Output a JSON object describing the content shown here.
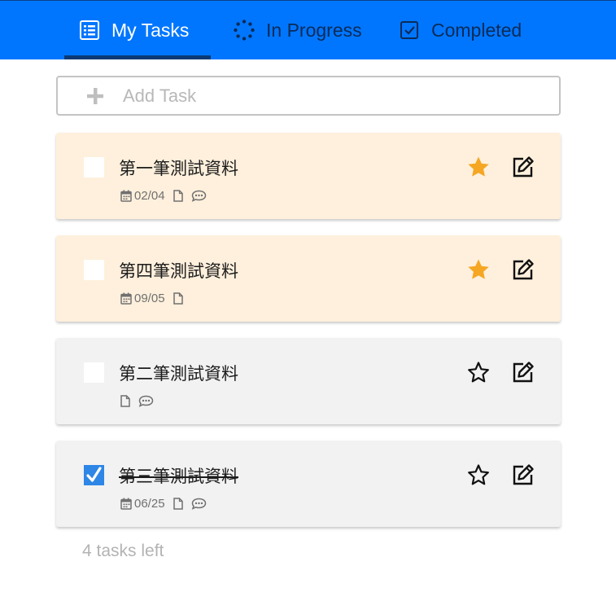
{
  "tabs": [
    {
      "label": "My Tasks",
      "icon": "list-icon",
      "active": true
    },
    {
      "label": "In Progress",
      "icon": "spinner-icon",
      "active": false
    },
    {
      "label": "Completed",
      "icon": "checkbox-icon",
      "active": false
    }
  ],
  "add_task": {
    "placeholder": "Add Task",
    "value": "",
    "icon": "plus-icon"
  },
  "tasks": [
    {
      "title": "第一筆測試資料",
      "date": "02/04",
      "has_file": true,
      "has_comment": true,
      "starred": true,
      "completed": false
    },
    {
      "title": "第四筆測試資料",
      "date": "09/05",
      "has_file": true,
      "has_comment": false,
      "starred": true,
      "completed": false
    },
    {
      "title": "第二筆測試資料",
      "date": "",
      "has_file": true,
      "has_comment": true,
      "starred": false,
      "completed": false
    },
    {
      "title": "第三筆測試資料",
      "date": "06/25",
      "has_file": true,
      "has_comment": true,
      "starred": false,
      "completed": true
    }
  ],
  "footer": {
    "tasks_left": "4 tasks left"
  },
  "colors": {
    "header_bg": "#0076ff",
    "tab_active": "#ffffff",
    "tab_inactive": "#0a2b58",
    "starred_card_bg": "#fef0dc",
    "plain_card_bg": "#f2f2f2",
    "star_filled": "#f5a623",
    "checked": "#2e86e6"
  }
}
